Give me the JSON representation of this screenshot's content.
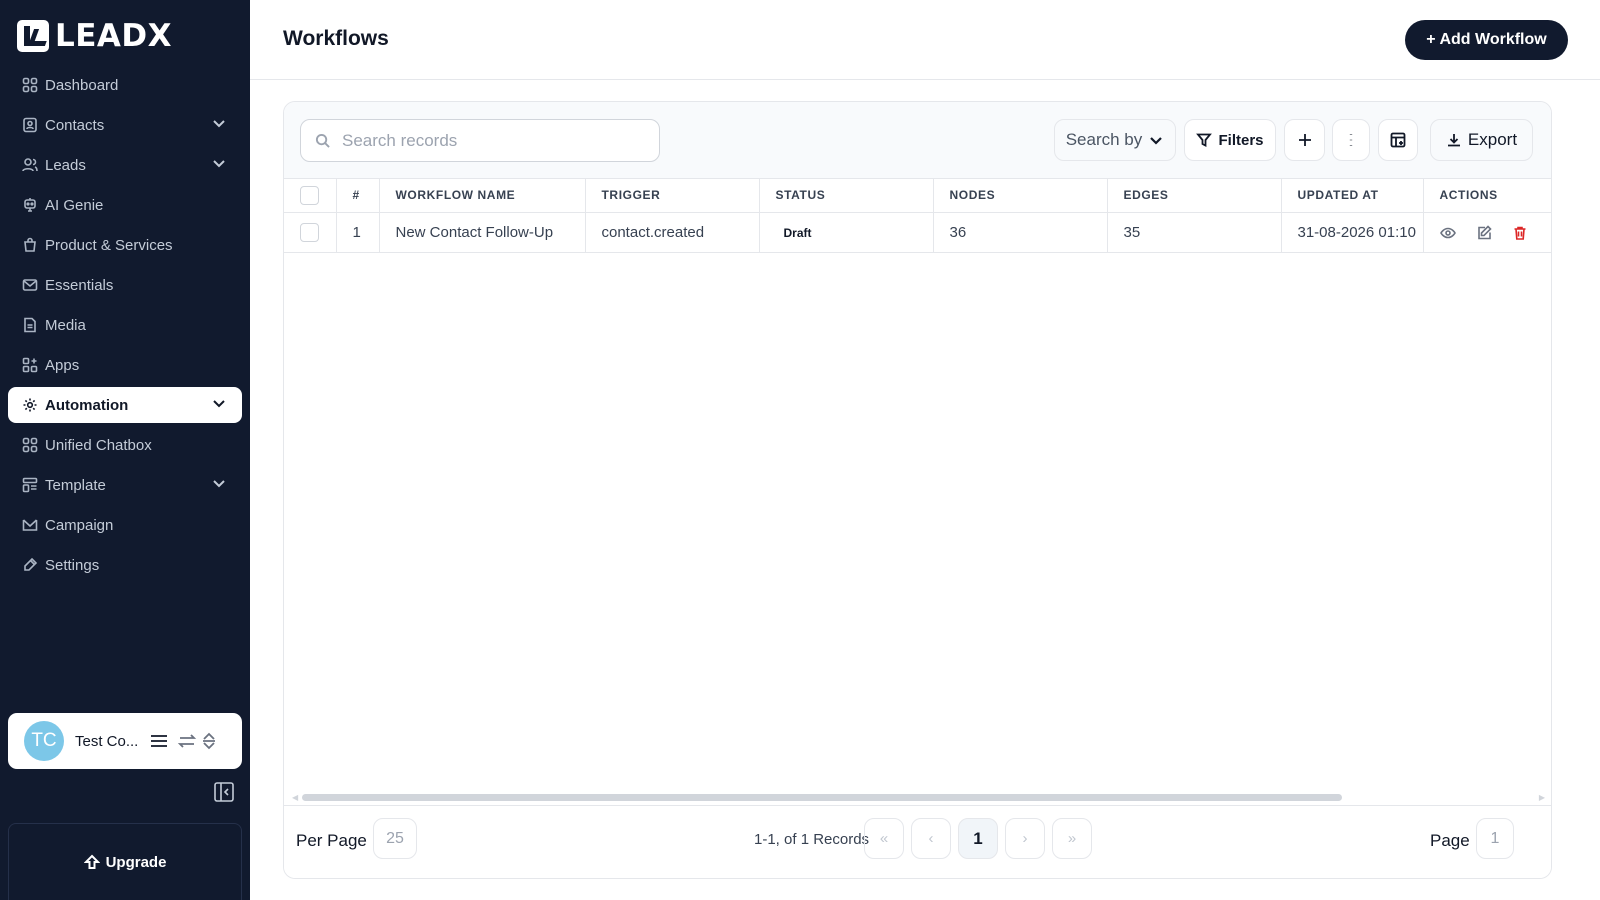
{
  "brand": {
    "name": "LEADX"
  },
  "sidebar": {
    "items": [
      {
        "label": "Dashboard",
        "icon": "dashboard-icon",
        "has_chevron": false
      },
      {
        "label": "Contacts",
        "icon": "contacts-icon",
        "has_chevron": true
      },
      {
        "label": "Leads",
        "icon": "leads-icon",
        "has_chevron": true
      },
      {
        "label": "AI Genie",
        "icon": "ai-genie-icon",
        "has_chevron": false
      },
      {
        "label": "Product & Services",
        "icon": "bag-icon",
        "has_chevron": false
      },
      {
        "label": "Essentials",
        "icon": "mail-icon",
        "has_chevron": false
      },
      {
        "label": "Media",
        "icon": "file-icon",
        "has_chevron": false
      },
      {
        "label": "Apps",
        "icon": "apps-icon",
        "has_chevron": false
      },
      {
        "label": "Automation",
        "icon": "automation-gear-icon",
        "has_chevron": true,
        "active": true
      },
      {
        "label": "Unified Chatbox",
        "icon": "grid-icon",
        "has_chevron": false
      },
      {
        "label": "Template",
        "icon": "template-icon",
        "has_chevron": true
      },
      {
        "label": "Campaign",
        "icon": "campaign-icon",
        "has_chevron": false
      },
      {
        "label": "Settings",
        "icon": "settings-icon",
        "has_chevron": false
      }
    ],
    "user": {
      "initials": "TC",
      "name": "Test Co..."
    },
    "upgrade_label": "Upgrade"
  },
  "header": {
    "title": "Workflows",
    "add_label": "+ Add Workflow"
  },
  "toolbar": {
    "search_placeholder": "Search records",
    "search_by_label": "Search by",
    "filters_label": "Filters",
    "export_label": "Export"
  },
  "table": {
    "columns": [
      "#",
      "WORKFLOW NAME",
      "TRIGGER",
      "STATUS",
      "NODES",
      "EDGES",
      "UPDATED AT",
      "ACTIONS"
    ],
    "rows": [
      {
        "index": "1",
        "name": "New Contact Follow-Up",
        "trigger": "contact.created",
        "status": "Draft",
        "nodes": "36",
        "edges": "35",
        "updated_at": "31-08-2026 01:10"
      }
    ]
  },
  "footer": {
    "per_page_label": "Per Page",
    "per_page_value": "25",
    "records_text": "1-1, of 1 Records",
    "first_label": "«",
    "prev_label": "‹",
    "current_page": "1",
    "next_label": "›",
    "last_label": "»",
    "page_label": "Page",
    "page_value": "1"
  },
  "colors": {
    "sidebar_bg": "#111a2e",
    "primary_button": "#111a2e",
    "delete": "#dc2626",
    "avatar": "#7cc7e8"
  }
}
